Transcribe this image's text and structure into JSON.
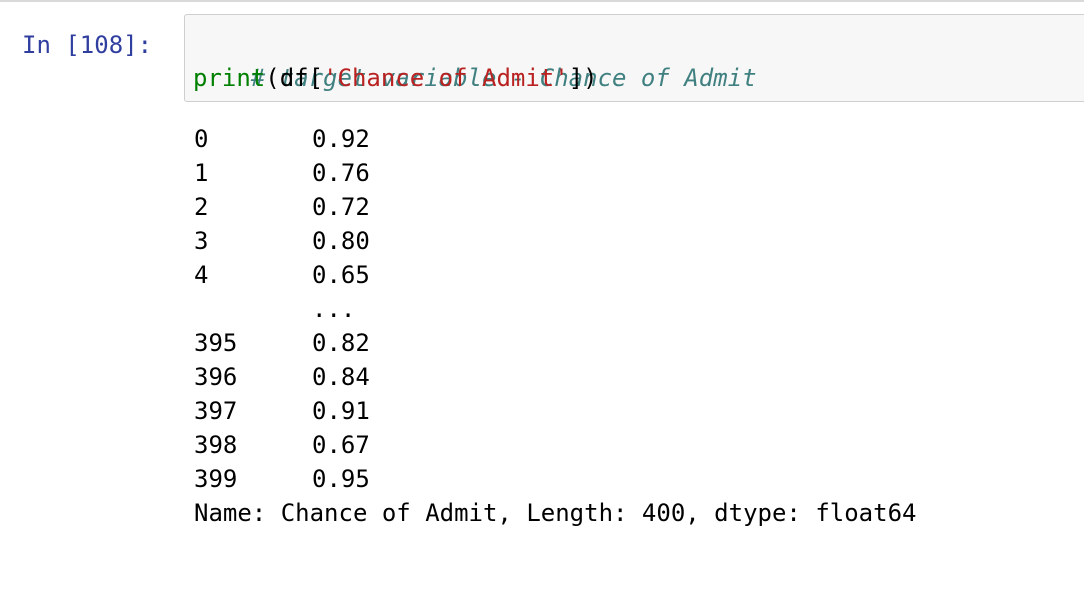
{
  "cell": {
    "prompt": "In [108]:",
    "code": {
      "comment": "# target variable - Chance of Admit",
      "line2": {
        "func": "print",
        "open": "(df[",
        "string": "'Chance of Admit'",
        "close": "])"
      }
    }
  },
  "output": {
    "rows": [
      {
        "index": "0",
        "value": "0.92"
      },
      {
        "index": "1",
        "value": "0.76"
      },
      {
        "index": "2",
        "value": "0.72"
      },
      {
        "index": "3",
        "value": "0.80"
      },
      {
        "index": "4",
        "value": "0.65"
      },
      {
        "index": "",
        "value": "..."
      },
      {
        "index": "395",
        "value": "0.82"
      },
      {
        "index": "396",
        "value": "0.84"
      },
      {
        "index": "397",
        "value": "0.91"
      },
      {
        "index": "398",
        "value": "0.67"
      },
      {
        "index": "399",
        "value": "0.95"
      }
    ],
    "footer": "Name: Chance of Admit, Length: 400, dtype: float64"
  },
  "colors": {
    "prompt": "#303f9f",
    "comment": "#408080",
    "builtin": "#008000",
    "string": "#ba2121",
    "input_bg": "#f7f7f7"
  }
}
